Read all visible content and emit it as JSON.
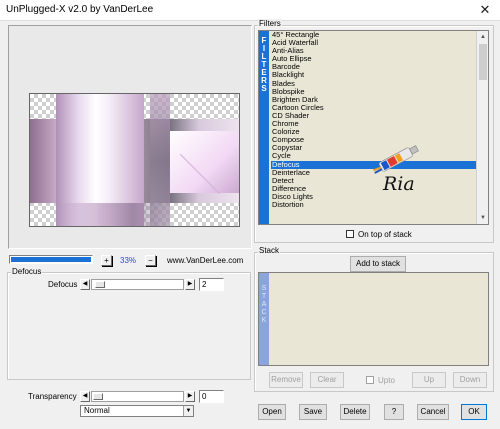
{
  "window": {
    "title": "UnPlugged-X v2.0 by VanDerLee",
    "close_glyph": "✕"
  },
  "preview": {
    "zoom_plus": "+",
    "zoom_value": "33%",
    "zoom_minus": "−",
    "credit": "www.VanDerLee.com",
    "progress_fraction": 0.98
  },
  "defocus_group": {
    "title": "Defocus",
    "param_label": "Defocus",
    "param_value": "2",
    "param_slider_fraction": 0.03
  },
  "transparency": {
    "label": "Transparency",
    "value": "0",
    "slider_fraction": 0.0,
    "blend_mode": "Normal"
  },
  "filters": {
    "title": "Filters",
    "band_letters": [
      "F",
      "I",
      "L",
      "T",
      "E",
      "R",
      "S"
    ],
    "items": [
      "45° Rectangle",
      "Acid Waterfall",
      "Anti-Alias",
      "Auto Ellipse",
      "Barcode",
      "Blacklight",
      "Blades",
      "Blobspike",
      "Brighten Dark",
      "Cartoon Circles",
      "CD Shader",
      "Chrome",
      "Colorize",
      "Compose",
      "Copystar",
      "Cycle",
      "Defocus",
      "Deinterlace",
      "Detect",
      "Difference",
      "Disco Lights",
      "Distortion"
    ],
    "selected_index": 16,
    "on_top_label": "On top of stack",
    "watermark_text": "Ria"
  },
  "stack": {
    "title": "Stack",
    "add_button": "Add to stack",
    "band_letters": [
      "S",
      "T",
      "A",
      "C",
      "K"
    ],
    "remove": "Remove",
    "clear": "Clear",
    "upto": "Upto",
    "up": "Up",
    "down": "Down"
  },
  "footer": {
    "open": "Open",
    "save": "Save",
    "delete": "Delete",
    "help": "?",
    "cancel": "Cancel",
    "ok": "OK"
  },
  "colors": {
    "accent": "#1a72d6",
    "stack_band": "#8aa4dd",
    "list_bg": "#eae6d6"
  }
}
